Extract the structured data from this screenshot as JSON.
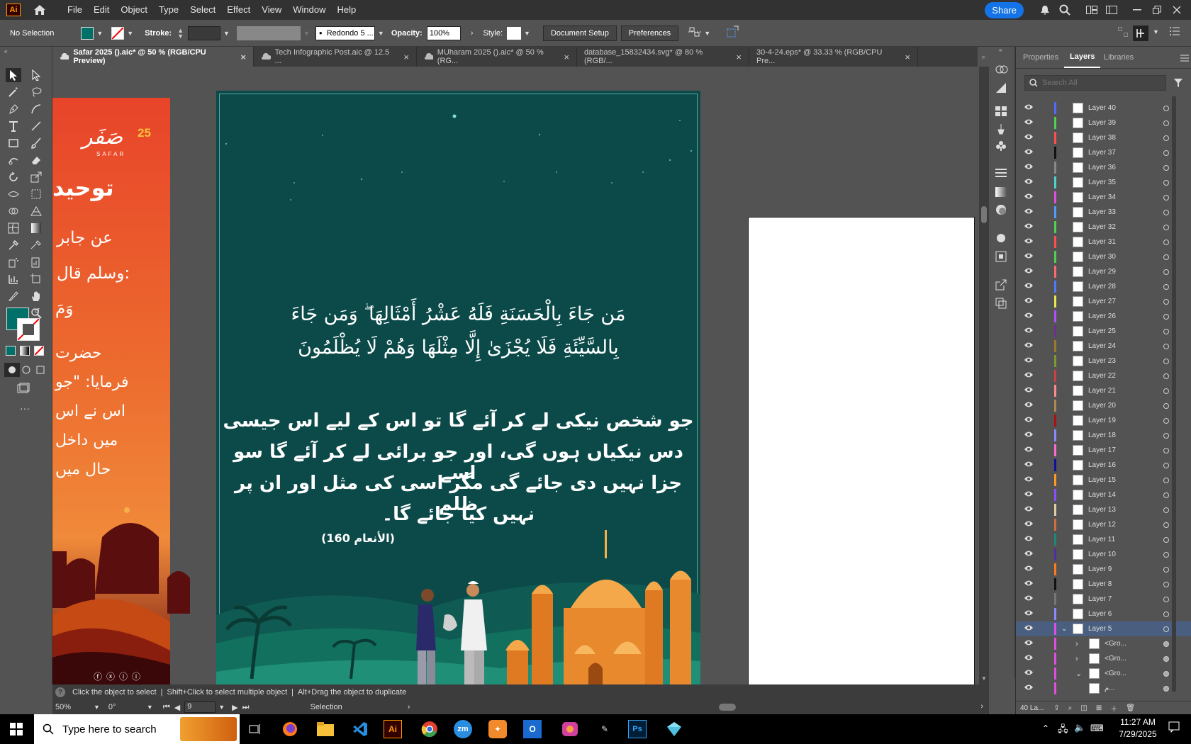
{
  "menubar": {
    "app_logo": "Ai",
    "menus": [
      "File",
      "Edit",
      "Object",
      "Type",
      "Select",
      "Effect",
      "View",
      "Window",
      "Help"
    ],
    "share": "Share"
  },
  "control": {
    "selection": "No Selection",
    "fill_color": "#007168",
    "stroke_label": "Stroke:",
    "brush": "Redondo 5 ...",
    "opacity_label": "Opacity:",
    "opacity_value": "100%",
    "style_label": "Style:",
    "doc_setup": "Document Setup",
    "preferences": "Preferences"
  },
  "tabs": [
    {
      "label": "Safar 2025 ().aic* @ 50 % (RGB/CPU Preview)",
      "active": true
    },
    {
      "label": "Tech Infographic Post.aic @ 12.5 ...",
      "active": false
    },
    {
      "label": "MUharam 2025 ().aic* @ 50 % (RG...",
      "active": false
    },
    {
      "label": "database_15832434.svg* @ 80 % (RGB/...",
      "active": false
    },
    {
      "label": "30-4-24.eps* @ 33.33 % (RGB/CPU Pre...",
      "active": false
    }
  ],
  "artwork": {
    "left_logo": "صَفَر",
    "left_logo_num": "25",
    "left_logo_sub": "SAFAR",
    "left_texts": [
      "توحید",
      "عن جابر",
      "وسلم قال:",
      "وَمَ",
      "حضرت",
      "فرمایا: \"جو",
      "اس نے اس",
      "میں داخل",
      "حال میں"
    ],
    "arabic_line1": "مَن جَاءَ بِالْحَسَنَةِ فَلَهُ عَشْرُ أَمْثَالِهَا ۖ وَمَن جَاءَ",
    "arabic_line2": "بِالسَّيِّئَةِ فَلَا يُجْزَىٰ إِلَّا مِثْلَهَا وَهُمْ لَا يُظْلَمُونَ",
    "urdu_lines": [
      "جو شخص نیکی لے کر آئے گا تو اس کے لیے اس جیسی",
      "دس نیکیاں ہوں گی، اور جو برائی لے کر آئے گا سو اسے",
      "جزا نہیں دی جائے گی مگر اسی کی مثل اور ان پر ظلم",
      "نہیں کیا جائے گا۔"
    ],
    "reference": "(الأنعام 160)"
  },
  "panels": {
    "tabs": [
      "Properties",
      "Layers",
      "Libraries"
    ],
    "search_placeholder": "Search All",
    "layers": [
      {
        "name": "Layer 40",
        "color": "#4f6bff"
      },
      {
        "name": "Layer 39",
        "color": "#4fd24f"
      },
      {
        "name": "Layer 38",
        "color": "#ff4f4f"
      },
      {
        "name": "Layer 37",
        "color": "#111111"
      },
      {
        "name": "Layer 36",
        "color": "#888888"
      },
      {
        "name": "Layer 35",
        "color": "#4fd2d2"
      },
      {
        "name": "Layer 34",
        "color": "#e04fe0"
      },
      {
        "name": "Layer 33",
        "color": "#4f9bff"
      },
      {
        "name": "Layer 32",
        "color": "#4fd24f"
      },
      {
        "name": "Layer 31",
        "color": "#ff4f4f"
      },
      {
        "name": "Layer 30",
        "color": "#4fd24f"
      },
      {
        "name": "Layer 29",
        "color": "#ff6b6b"
      },
      {
        "name": "Layer 28",
        "color": "#4f7bff"
      },
      {
        "name": "Layer 27",
        "color": "#e8e84f"
      },
      {
        "name": "Layer 26",
        "color": "#b04fff"
      },
      {
        "name": "Layer 25",
        "color": "#6f2f8f"
      },
      {
        "name": "Layer 24",
        "color": "#9a7b2a"
      },
      {
        "name": "Layer 23",
        "color": "#7b9a2a"
      },
      {
        "name": "Layer 22",
        "color": "#d04040"
      },
      {
        "name": "Layer 21",
        "color": "#ff8a8a"
      },
      {
        "name": "Layer 20",
        "color": "#b08a4f"
      },
      {
        "name": "Layer 19",
        "color": "#b01010"
      },
      {
        "name": "Layer 18",
        "color": "#8a8aff"
      },
      {
        "name": "Layer 17",
        "color": "#ff6bd0"
      },
      {
        "name": "Layer 16",
        "color": "#1010a0"
      },
      {
        "name": "Layer 15",
        "color": "#ff9a1a"
      },
      {
        "name": "Layer 14",
        "color": "#8a4fff"
      },
      {
        "name": "Layer 13",
        "color": "#e0d0a0"
      },
      {
        "name": "Layer 12",
        "color": "#d0703a"
      },
      {
        "name": "Layer 11",
        "color": "#1a8a7a"
      },
      {
        "name": "Layer 10",
        "color": "#4f2fa0"
      },
      {
        "name": "Layer 9",
        "color": "#ff7a1a"
      },
      {
        "name": "Layer 8",
        "color": "#111111"
      },
      {
        "name": "Layer 7",
        "color": "#777777"
      },
      {
        "name": "Layer 6",
        "color": "#8a8aff"
      },
      {
        "name": "Layer 5",
        "color": "#e04fe0"
      },
      {
        "name": "<Gro...",
        "color": "#e04fe0"
      },
      {
        "name": "<Gro...",
        "color": "#e04fe0"
      },
      {
        "name": "<Gro...",
        "color": "#e04fe0"
      },
      {
        "name": "م...",
        "color": "#e04fe0"
      }
    ],
    "layer_count": "40 La..."
  },
  "status": {
    "hint1": "Click the object to select",
    "hint2": "Shift+Click to select multiple object",
    "hint3": "Alt+Drag the object to duplicate",
    "zoom": "50%",
    "rotation": "0°",
    "artboard_num": "9",
    "tool": "Selection"
  },
  "taskbar": {
    "search": "Type here to search",
    "time": "11:27 AM",
    "date": "7/29/2025"
  }
}
